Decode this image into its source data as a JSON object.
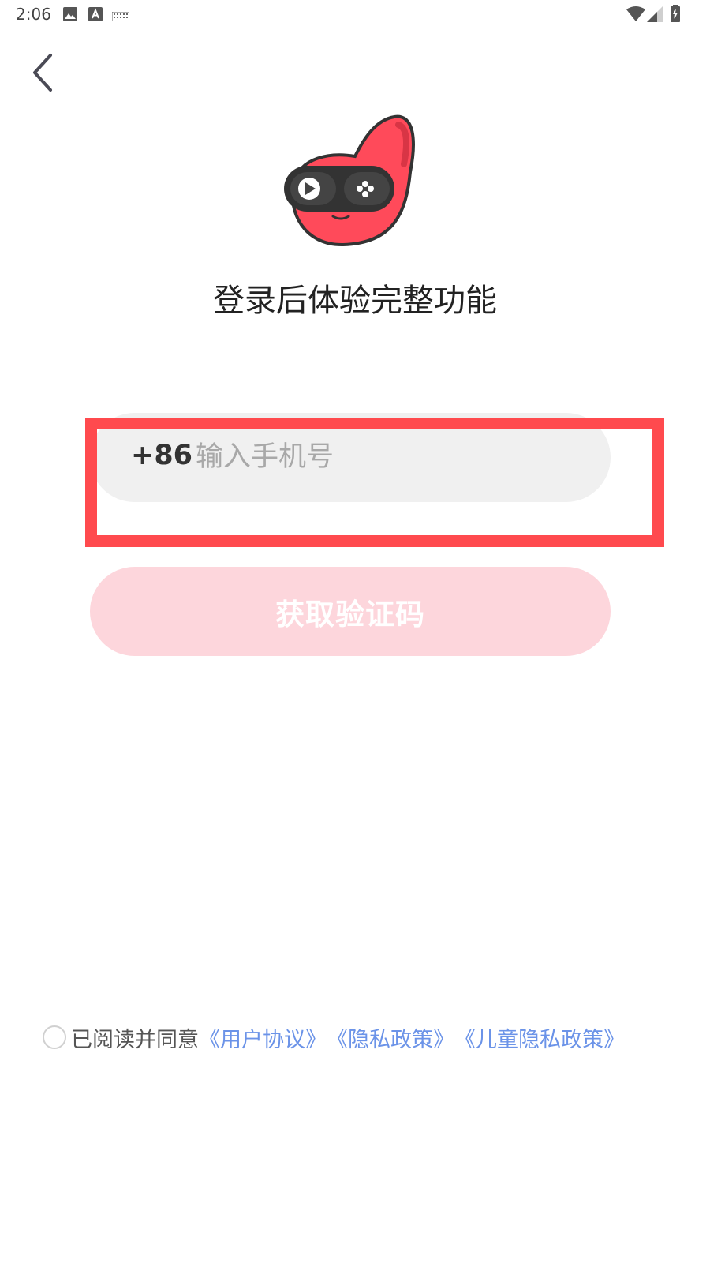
{
  "status_bar": {
    "time": "2:06",
    "icons": [
      "image-icon",
      "a-icon",
      "keyboard-icon",
      "wifi-icon",
      "signal-icon",
      "battery-icon"
    ]
  },
  "header": {
    "back_icon": "chevron-left-icon"
  },
  "main": {
    "mascot_icon": "red-gamepad-mascot",
    "title": "登录后体验完整功能",
    "phone": {
      "country_code": "+86",
      "placeholder": "输入手机号",
      "value": ""
    },
    "get_code_label": "获取验证码"
  },
  "agreement": {
    "prefix": "已阅读并同意",
    "links": [
      "《用户协议》",
      "《隐私政策》",
      "《儿童隐私政策》"
    ]
  },
  "colors": {
    "accent": "#ff4a4e",
    "button_disabled": "#fdd6dc",
    "input_bg": "#f0f0f0",
    "link": "#6b93e8"
  }
}
